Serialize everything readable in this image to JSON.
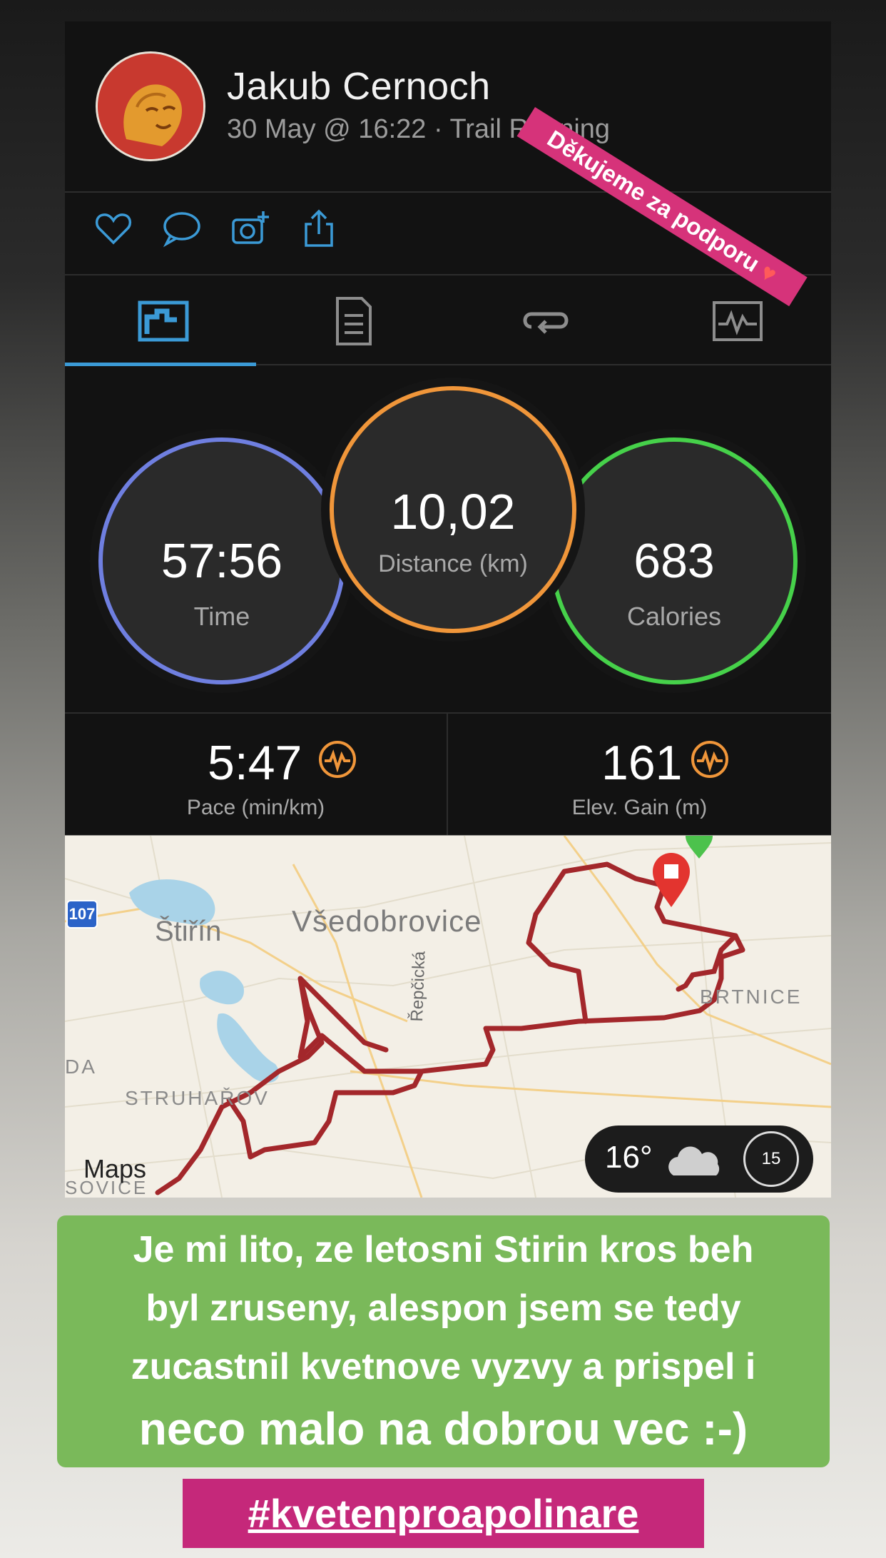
{
  "profile": {
    "name": "Jakub Cernoch",
    "subtitle": "30 May @ 16:22 · Trail Running"
  },
  "sticker": {
    "text": "Děkujeme za podporu"
  },
  "actions": [
    "heart-icon",
    "comment-icon",
    "camera-add-icon",
    "share-icon"
  ],
  "tabs": [
    "stats-tab-icon",
    "details-tab-icon",
    "laps-tab-icon",
    "chart-tab-icon"
  ],
  "circles": {
    "time": {
      "value": "57:56",
      "label": "Time"
    },
    "distance": {
      "value": "10,02",
      "label": "Distance (km)"
    },
    "calories": {
      "value": "683",
      "label": "Calories"
    }
  },
  "stats": {
    "pace": {
      "value": "5:47",
      "label": "Pace (min/km)"
    },
    "elev": {
      "value": "161",
      "label": "Elev. Gain (m)"
    }
  },
  "map": {
    "road_badge": "107",
    "places": {
      "stirin": "Štiřín",
      "vsedobrovice": "Všedobrovice",
      "brtnice": "BRTNICE",
      "struharov": "STRUHAŘOV",
      "da": "DA",
      "sovice": "SOVICE",
      "street": "Řepčická"
    },
    "brand": "Maps",
    "weather": {
      "temp": "16°",
      "badge": "15"
    }
  },
  "caption": {
    "lines": [
      "Je mi lito, ze letosni Stirin kros beh",
      "byl zruseny, alespon jsem se tedy",
      "zucastnil kvetnove vyzvy a prispel i",
      "neco malo na dobrou vec :-)"
    ]
  },
  "hashtag": "#kvetenproapolinare",
  "colors": {
    "accent_blue": "#3b9ad6",
    "time_ring": "#6f7fe0",
    "distance_ring": "#f0963a",
    "calories_ring": "#46d14a",
    "route": "#a3272b",
    "sticker": "#d6337a",
    "caption_bg": "#7ab95a",
    "hashtag_bg": "#c5287a"
  }
}
